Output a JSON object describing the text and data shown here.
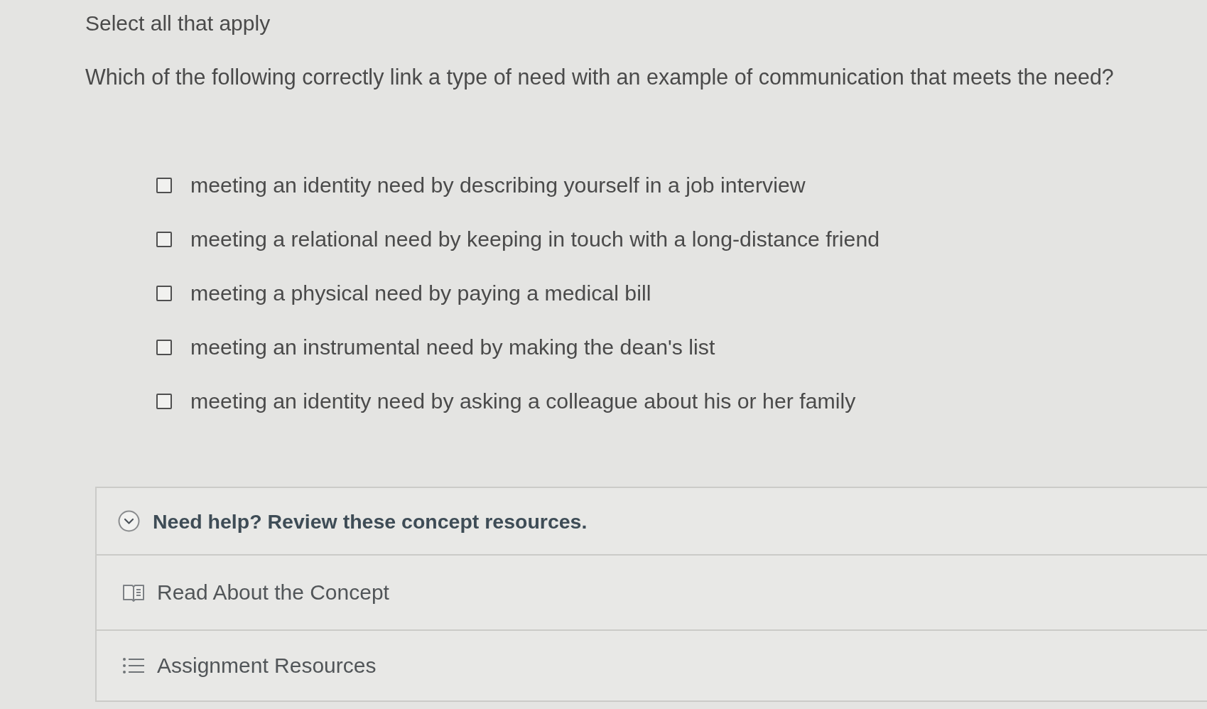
{
  "instruction": "Select all that apply",
  "question": "Which of the following correctly link a type of need with an example of communication that meets the need?",
  "options": [
    {
      "label": "meeting an identity need by describing yourself in a job interview",
      "checked": false
    },
    {
      "label": "meeting a relational need by keeping in touch with a long-distance friend",
      "checked": false
    },
    {
      "label": "meeting a physical need by paying a medical bill",
      "checked": false
    },
    {
      "label": "meeting an instrumental need by making the dean's list",
      "checked": false
    },
    {
      "label": "meeting an identity need by asking a colleague about his or her family",
      "checked": false
    }
  ],
  "help": {
    "title": "Need help? Review these concept resources.",
    "expanded": true,
    "resources": [
      {
        "kind": "reading",
        "label": "Read About the Concept"
      },
      {
        "kind": "list",
        "label": "Assignment Resources"
      }
    ]
  }
}
